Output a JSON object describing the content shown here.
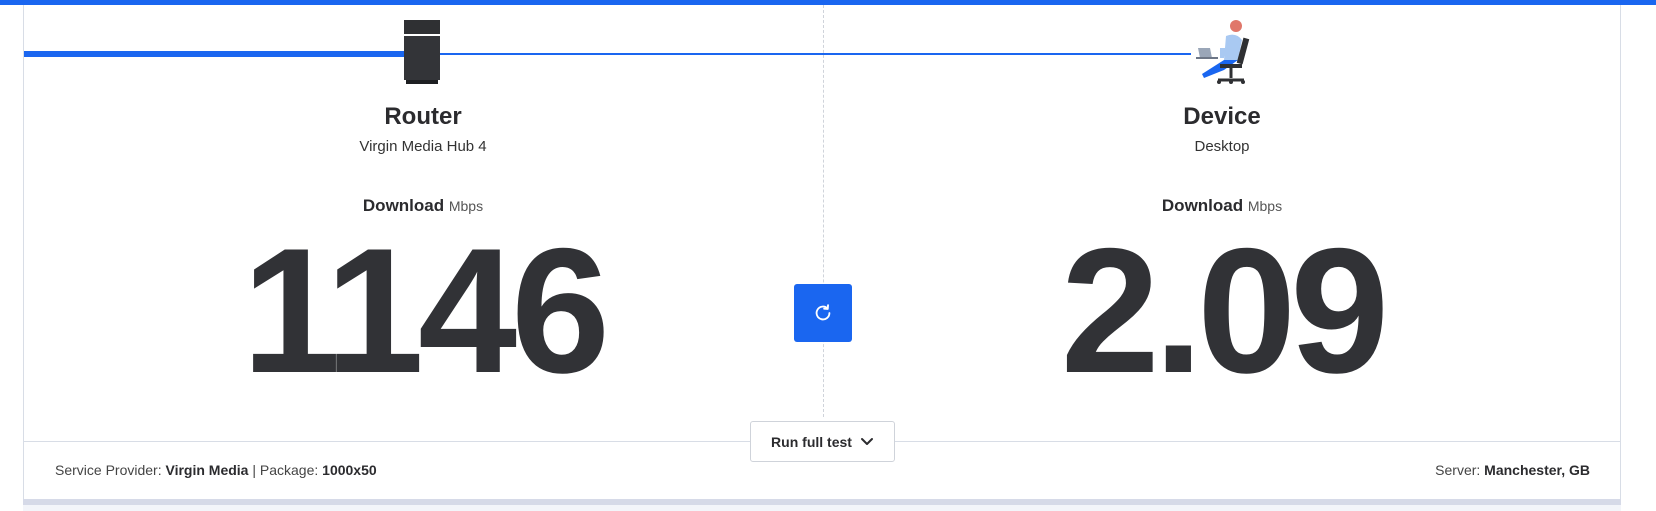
{
  "router": {
    "title": "Router",
    "subtitle": "Virgin Media Hub 4",
    "download_label": "Download",
    "unit": "Mbps",
    "value": "1146"
  },
  "device": {
    "title": "Device",
    "subtitle": "Desktop",
    "download_label": "Download",
    "unit": "Mbps",
    "value": "2.09"
  },
  "actions": {
    "refresh_icon": "refresh-icon",
    "run_full_test_label": "Run full test"
  },
  "footer": {
    "provider_label": "Service Provider:",
    "provider_value": "Virgin Media",
    "separator": "|",
    "package_label": "Package:",
    "package_value": "1000x50",
    "server_label": "Server:",
    "server_value": "Manchester, GB"
  },
  "colors": {
    "accent": "#1a66f0",
    "text": "#313236",
    "border": "#d8dde6"
  }
}
